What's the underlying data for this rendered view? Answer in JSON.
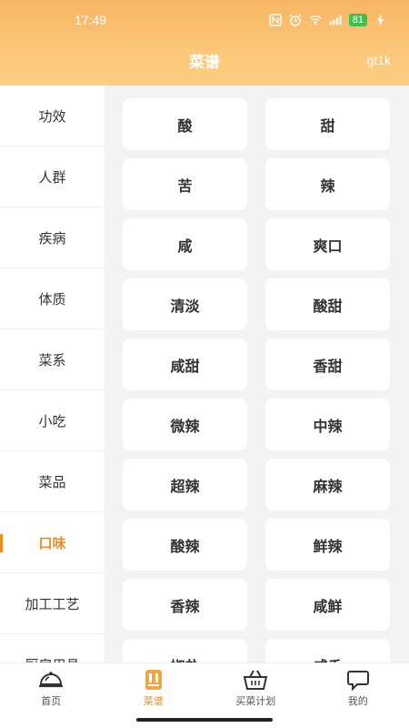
{
  "status": {
    "time": "17:49",
    "battery": "81"
  },
  "header": {
    "title": "菜谱",
    "user": "gt1k"
  },
  "sidebar": {
    "items": [
      {
        "label": "功效"
      },
      {
        "label": "人群"
      },
      {
        "label": "疾病"
      },
      {
        "label": "体质"
      },
      {
        "label": "菜系"
      },
      {
        "label": "小吃"
      },
      {
        "label": "菜品"
      },
      {
        "label": "口味",
        "active": true
      },
      {
        "label": "加工工艺"
      },
      {
        "label": "厨房用具"
      }
    ]
  },
  "tags": [
    "酸",
    "甜",
    "苦",
    "辣",
    "咸",
    "爽口",
    "清淡",
    "酸甜",
    "咸甜",
    "香甜",
    "微辣",
    "中辣",
    "超辣",
    "麻辣",
    "酸辣",
    "鲜辣",
    "香辣",
    "咸鲜",
    "椒盐",
    "咸香"
  ],
  "tabbar": {
    "items": [
      {
        "label": "首页",
        "icon": "cloche-icon"
      },
      {
        "label": "菜谱",
        "icon": "recipe-book-icon",
        "active": true
      },
      {
        "label": "买菜计划",
        "icon": "basket-icon"
      },
      {
        "label": "我的",
        "icon": "chat-bubble-icon"
      }
    ]
  },
  "colors": {
    "accent": "#f08a1e",
    "header": "#f7b665"
  }
}
